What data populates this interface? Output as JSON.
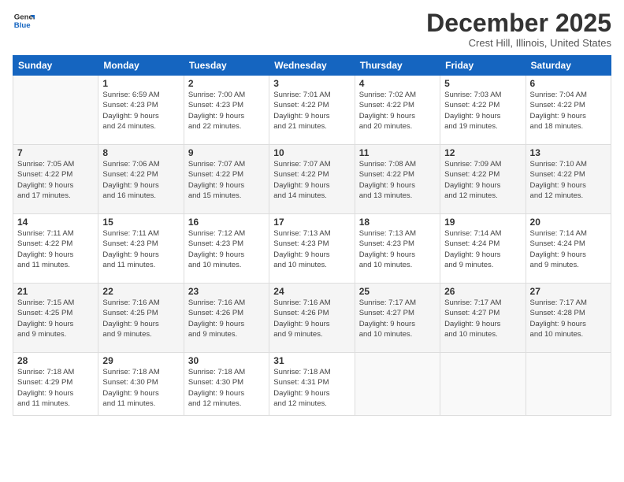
{
  "logo": {
    "line1": "General",
    "line2": "Blue"
  },
  "title": "December 2025",
  "location": "Crest Hill, Illinois, United States",
  "days_of_week": [
    "Sunday",
    "Monday",
    "Tuesday",
    "Wednesday",
    "Thursday",
    "Friday",
    "Saturday"
  ],
  "weeks": [
    [
      {
        "day": "",
        "info": ""
      },
      {
        "day": "1",
        "info": "Sunrise: 6:59 AM\nSunset: 4:23 PM\nDaylight: 9 hours\nand 24 minutes."
      },
      {
        "day": "2",
        "info": "Sunrise: 7:00 AM\nSunset: 4:23 PM\nDaylight: 9 hours\nand 22 minutes."
      },
      {
        "day": "3",
        "info": "Sunrise: 7:01 AM\nSunset: 4:22 PM\nDaylight: 9 hours\nand 21 minutes."
      },
      {
        "day": "4",
        "info": "Sunrise: 7:02 AM\nSunset: 4:22 PM\nDaylight: 9 hours\nand 20 minutes."
      },
      {
        "day": "5",
        "info": "Sunrise: 7:03 AM\nSunset: 4:22 PM\nDaylight: 9 hours\nand 19 minutes."
      },
      {
        "day": "6",
        "info": "Sunrise: 7:04 AM\nSunset: 4:22 PM\nDaylight: 9 hours\nand 18 minutes."
      }
    ],
    [
      {
        "day": "7",
        "info": "Sunrise: 7:05 AM\nSunset: 4:22 PM\nDaylight: 9 hours\nand 17 minutes."
      },
      {
        "day": "8",
        "info": "Sunrise: 7:06 AM\nSunset: 4:22 PM\nDaylight: 9 hours\nand 16 minutes."
      },
      {
        "day": "9",
        "info": "Sunrise: 7:07 AM\nSunset: 4:22 PM\nDaylight: 9 hours\nand 15 minutes."
      },
      {
        "day": "10",
        "info": "Sunrise: 7:07 AM\nSunset: 4:22 PM\nDaylight: 9 hours\nand 14 minutes."
      },
      {
        "day": "11",
        "info": "Sunrise: 7:08 AM\nSunset: 4:22 PM\nDaylight: 9 hours\nand 13 minutes."
      },
      {
        "day": "12",
        "info": "Sunrise: 7:09 AM\nSunset: 4:22 PM\nDaylight: 9 hours\nand 12 minutes."
      },
      {
        "day": "13",
        "info": "Sunrise: 7:10 AM\nSunset: 4:22 PM\nDaylight: 9 hours\nand 12 minutes."
      }
    ],
    [
      {
        "day": "14",
        "info": "Sunrise: 7:11 AM\nSunset: 4:22 PM\nDaylight: 9 hours\nand 11 minutes."
      },
      {
        "day": "15",
        "info": "Sunrise: 7:11 AM\nSunset: 4:23 PM\nDaylight: 9 hours\nand 11 minutes."
      },
      {
        "day": "16",
        "info": "Sunrise: 7:12 AM\nSunset: 4:23 PM\nDaylight: 9 hours\nand 10 minutes."
      },
      {
        "day": "17",
        "info": "Sunrise: 7:13 AM\nSunset: 4:23 PM\nDaylight: 9 hours\nand 10 minutes."
      },
      {
        "day": "18",
        "info": "Sunrise: 7:13 AM\nSunset: 4:23 PM\nDaylight: 9 hours\nand 10 minutes."
      },
      {
        "day": "19",
        "info": "Sunrise: 7:14 AM\nSunset: 4:24 PM\nDaylight: 9 hours\nand 9 minutes."
      },
      {
        "day": "20",
        "info": "Sunrise: 7:14 AM\nSunset: 4:24 PM\nDaylight: 9 hours\nand 9 minutes."
      }
    ],
    [
      {
        "day": "21",
        "info": "Sunrise: 7:15 AM\nSunset: 4:25 PM\nDaylight: 9 hours\nand 9 minutes."
      },
      {
        "day": "22",
        "info": "Sunrise: 7:16 AM\nSunset: 4:25 PM\nDaylight: 9 hours\nand 9 minutes."
      },
      {
        "day": "23",
        "info": "Sunrise: 7:16 AM\nSunset: 4:26 PM\nDaylight: 9 hours\nand 9 minutes."
      },
      {
        "day": "24",
        "info": "Sunrise: 7:16 AM\nSunset: 4:26 PM\nDaylight: 9 hours\nand 9 minutes."
      },
      {
        "day": "25",
        "info": "Sunrise: 7:17 AM\nSunset: 4:27 PM\nDaylight: 9 hours\nand 10 minutes."
      },
      {
        "day": "26",
        "info": "Sunrise: 7:17 AM\nSunset: 4:27 PM\nDaylight: 9 hours\nand 10 minutes."
      },
      {
        "day": "27",
        "info": "Sunrise: 7:17 AM\nSunset: 4:28 PM\nDaylight: 9 hours\nand 10 minutes."
      }
    ],
    [
      {
        "day": "28",
        "info": "Sunrise: 7:18 AM\nSunset: 4:29 PM\nDaylight: 9 hours\nand 11 minutes."
      },
      {
        "day": "29",
        "info": "Sunrise: 7:18 AM\nSunset: 4:30 PM\nDaylight: 9 hours\nand 11 minutes."
      },
      {
        "day": "30",
        "info": "Sunrise: 7:18 AM\nSunset: 4:30 PM\nDaylight: 9 hours\nand 12 minutes."
      },
      {
        "day": "31",
        "info": "Sunrise: 7:18 AM\nSunset: 4:31 PM\nDaylight: 9 hours\nand 12 minutes."
      },
      {
        "day": "",
        "info": ""
      },
      {
        "day": "",
        "info": ""
      },
      {
        "day": "",
        "info": ""
      }
    ]
  ]
}
